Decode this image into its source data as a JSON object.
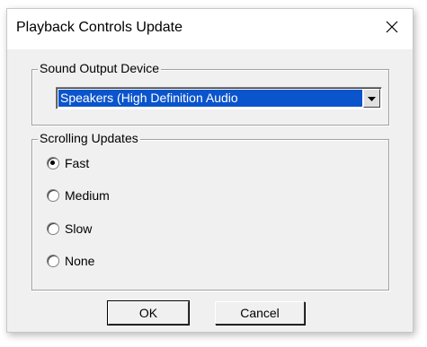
{
  "window": {
    "title": "Playback Controls Update"
  },
  "sound_output": {
    "group_label": "Sound Output Device",
    "selected_device": "Speakers (High Definition Audio"
  },
  "scrolling": {
    "group_label": "Scrolling Updates",
    "options": [
      {
        "label": "Fast",
        "checked": true
      },
      {
        "label": "Medium",
        "checked": false
      },
      {
        "label": "Slow",
        "checked": false
      },
      {
        "label": "None",
        "checked": false
      }
    ]
  },
  "buttons": {
    "ok_label": "OK",
    "cancel_label": "Cancel"
  },
  "icons": {
    "close": "close-icon",
    "dropdown": "chevron-down-icon"
  },
  "colors": {
    "selection": "#0a54cc",
    "dialog_bg": "#f0f0f0"
  }
}
